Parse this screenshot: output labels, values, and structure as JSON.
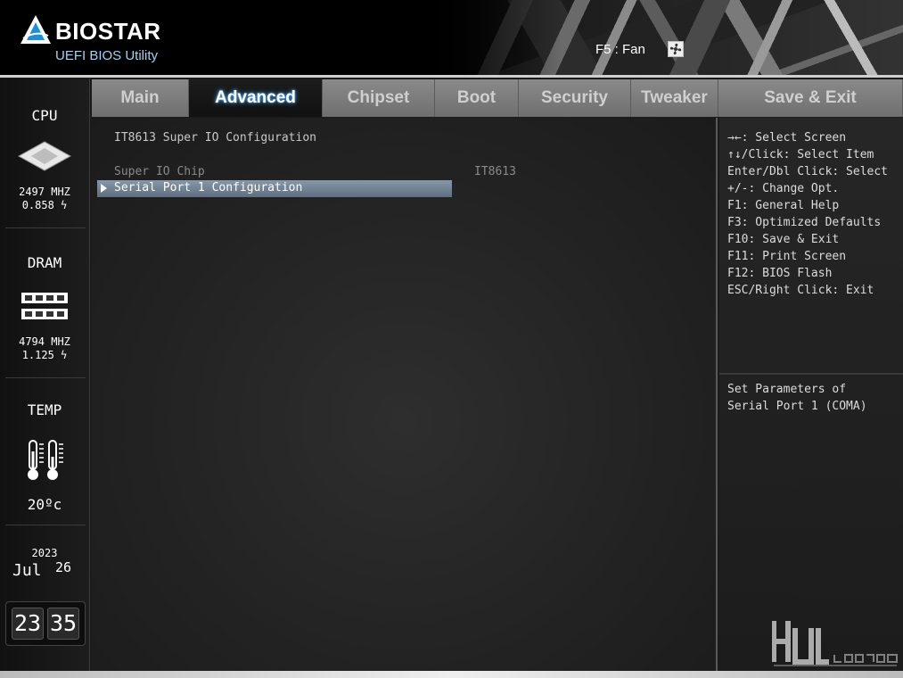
{
  "header": {
    "brand": "BIOSTAR",
    "subtitle": "UEFI BIOS Utility",
    "fan_hint": "F5 : Fan"
  },
  "sidebar": {
    "cpu": {
      "title": "CPU",
      "freq": "2497 MHZ",
      "volt": "0.858 ϟ"
    },
    "dram": {
      "title": "DRAM",
      "freq": "4794 MHZ",
      "volt": "1.125 ϟ"
    },
    "temp": {
      "title": "TEMP",
      "value": "20ºc"
    },
    "date": {
      "year": "2023",
      "month": "Jul",
      "day": "26"
    },
    "clock": {
      "hours": "23",
      "minutes": "35"
    }
  },
  "tabs": [
    {
      "label": "Main"
    },
    {
      "label": "Advanced"
    },
    {
      "label": "Chipset"
    },
    {
      "label": "Boot"
    },
    {
      "label": "Security"
    },
    {
      "label": "Tweaker"
    },
    {
      "label": "Save & Exit"
    }
  ],
  "active_tab": "Advanced",
  "main": {
    "title": "IT8613 Super IO Configuration",
    "rows": [
      {
        "label": "Super IO Chip",
        "value": "IT8613"
      },
      {
        "label": "Serial Port 1 Configuration",
        "value": ""
      }
    ]
  },
  "help": {
    "keys": [
      "→←: Select Screen",
      "↑↓/Click: Select Item",
      "Enter/Dbl Click: Select",
      "+/-: Change Opt.",
      "F1: General Help",
      "F3: Optimized Defaults",
      "F10: Save & Exit",
      "F11: Print Screen",
      "F12: BIOS Flash",
      "ESC/Right Click: Exit"
    ],
    "description": [
      "Set Parameters of",
      "Serial Port 1 (COMA)"
    ]
  },
  "watermark": {
    "logo": "hwl-legend-logo"
  }
}
